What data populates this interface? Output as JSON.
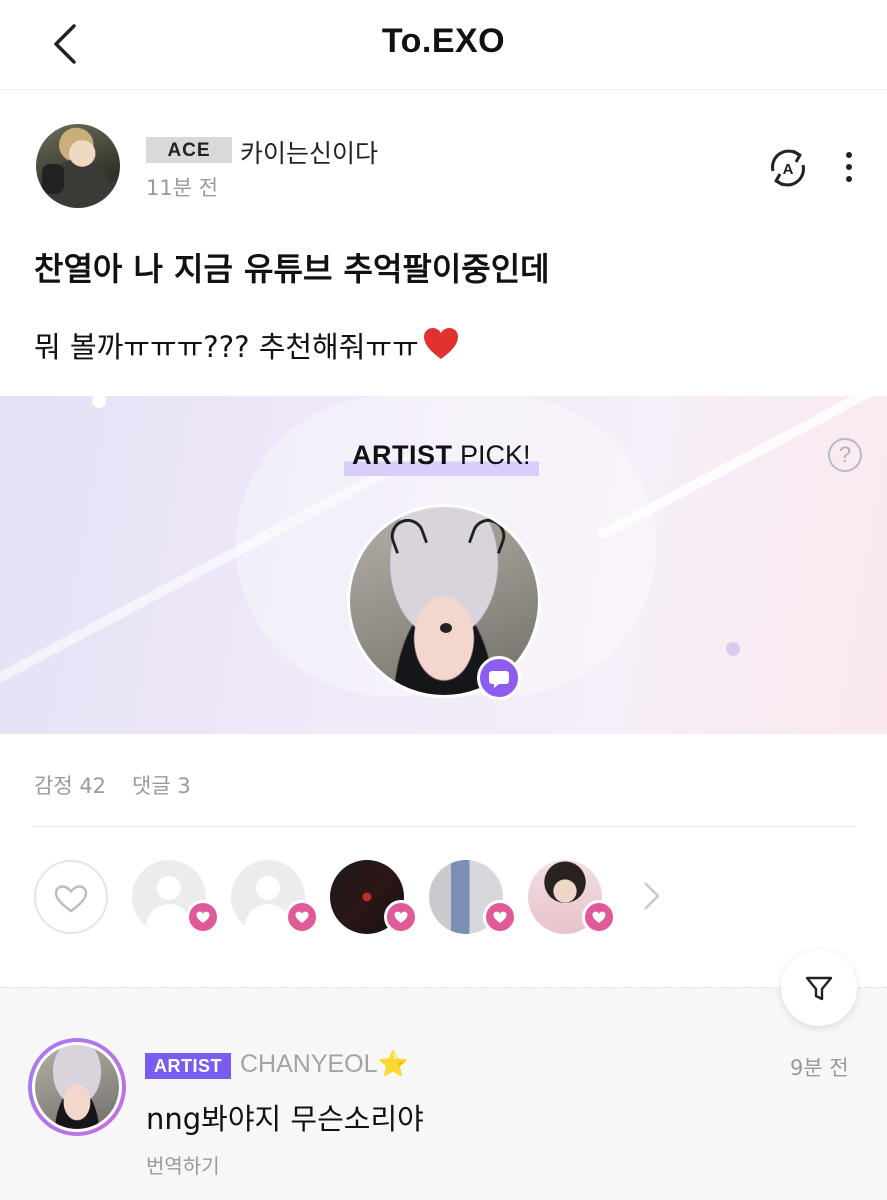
{
  "header": {
    "title": "To.EXO",
    "back_icon": "chevron-left-icon"
  },
  "post": {
    "author_badge": "ACE",
    "author_name": "카이는신이다",
    "time": "11분 전",
    "title": "찬열아 나 지금 유튜브 추억팔이중인데",
    "body": "뭐 볼까ㅠㅠㅠ??? 추천해줘ㅠㅠ",
    "body_emoji": "red-heart-icon",
    "translate_icon": "translate-icon",
    "more_icon": "more-vertical-icon"
  },
  "artist_pick": {
    "label_bold": "ARTIST",
    "label_rest": " PICK!",
    "help": "?",
    "accent_color": "#8c5df0"
  },
  "stats": {
    "emotions": "감정 42",
    "comments": "댓글 3"
  },
  "reactions": {
    "like_icon": "heart-outline-icon",
    "badge_color": "#e05a9a",
    "reactors": [
      "default-avatar",
      "default-avatar",
      "photo-avatar",
      "photo-avatar",
      "photo-avatar"
    ]
  },
  "comments": [
    {
      "badge": "ARTIST",
      "badge_color": "#7b5cf0",
      "name": "CHANYEOL",
      "name_emoji": "⭐",
      "time": "9분 전",
      "text": "nng봐야지 무슨소리야",
      "translate": "번역하기"
    }
  ],
  "filter_icon": "filter-icon"
}
